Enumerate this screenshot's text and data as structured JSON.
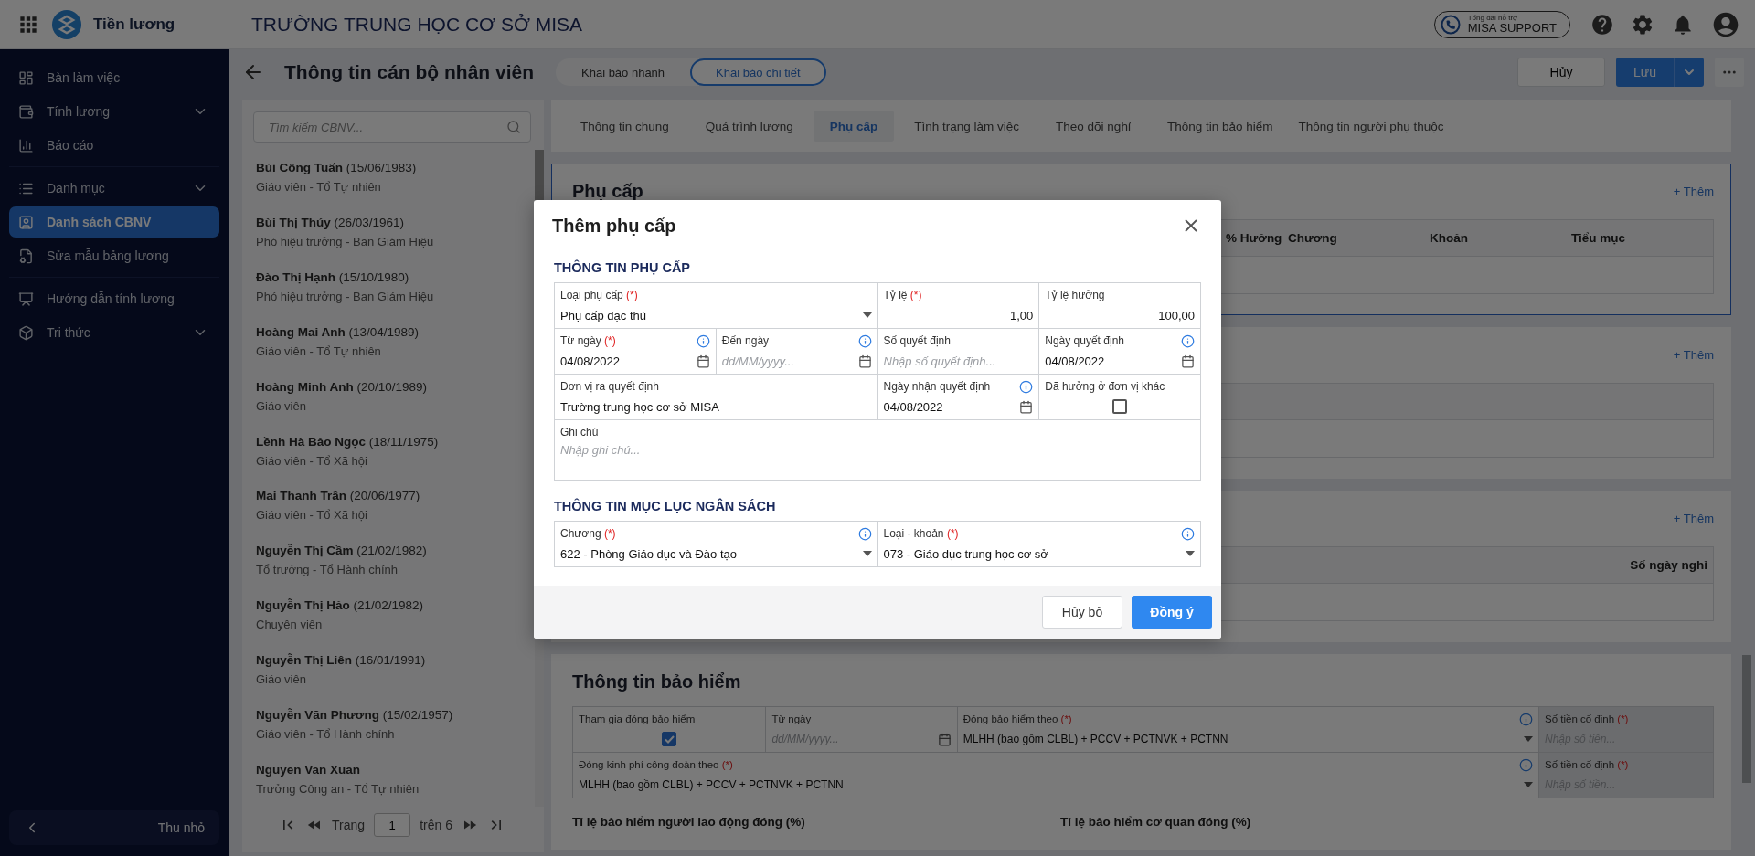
{
  "top_bar": {
    "app_name": "Tiền lương",
    "org_name": "TRƯỜNG TRUNG HỌC CƠ SỞ MISA",
    "support": {
      "caption": "Tổng đài hỗ trợ",
      "label": "MISA SUPPORT"
    }
  },
  "sidebar": {
    "groups": [
      {
        "items": [
          {
            "label": "Bàn làm việc",
            "selected": false,
            "expandable": false
          },
          {
            "label": "Tính lương",
            "selected": false,
            "expandable": true
          },
          {
            "label": "Báo cáo",
            "selected": false,
            "expandable": false
          }
        ]
      },
      {
        "items": [
          {
            "label": "Danh mục",
            "selected": false,
            "expandable": true
          },
          {
            "label": "Danh sách CBNV",
            "selected": true,
            "expandable": false
          },
          {
            "label": "Sửa mẫu bảng lương",
            "selected": false,
            "expandable": false
          }
        ]
      },
      {
        "items": [
          {
            "label": "Hướng dẫn tính lương",
            "selected": false,
            "expandable": false
          },
          {
            "label": "Tri thức",
            "selected": false,
            "expandable": true
          }
        ]
      }
    ],
    "collapse_label": "Thu nhỏ"
  },
  "page_header": {
    "title": "Thông tin cán bộ nhân viên",
    "modes": [
      {
        "label": "Khai báo nhanh",
        "selected": false
      },
      {
        "label": "Khai báo chi tiết",
        "selected": true
      }
    ],
    "cancel_label": "Hủy",
    "save_label": "Lưu"
  },
  "employee_list": {
    "search_placeholder": "Tìm kiếm CBNV...",
    "employees": [
      {
        "name": "Bùi Công Tuấn",
        "birth": "(15/06/1983)",
        "role": "Giáo viên - Tổ Tự nhiên"
      },
      {
        "name": "Bùi Thị Thúy",
        "birth": "(26/03/1961)",
        "role": "Phó hiệu trưởng - Ban Giám Hiệu"
      },
      {
        "name": "Đào Thị Hạnh",
        "birth": "(15/10/1980)",
        "role": "Phó hiệu trưởng - Ban Giám Hiệu"
      },
      {
        "name": "Hoàng Mai Anh",
        "birth": "(13/04/1989)",
        "role": "Giáo viên - Tổ Tự nhiên"
      },
      {
        "name": "Hoàng Minh Anh",
        "birth": "(20/10/1989)",
        "role": "Giáo viên"
      },
      {
        "name": "Lềnh Hà Bảo Ngọc",
        "birth": "(18/11/1975)",
        "role": "Giáo viên - Tổ Xã hội"
      },
      {
        "name": "Mai Thanh Trần",
        "birth": "(20/06/1977)",
        "role": "Giáo viên - Tổ Xã hội"
      },
      {
        "name": "Nguyễn Thị Cầm",
        "birth": "(21/02/1982)",
        "role": "Tổ trưởng - Tổ Hành chính"
      },
      {
        "name": "Nguyễn Thị Hảo",
        "birth": "(21/02/1982)",
        "role": "Chuyên viên"
      },
      {
        "name": "Nguyễn Thị Liên",
        "birth": "(16/01/1991)",
        "role": "Giáo viên"
      },
      {
        "name": "Nguyễn Văn Phương",
        "birth": "(15/02/1957)",
        "role": "Giáo viên - Tổ Hành chính"
      },
      {
        "name": "Nguyen Van Xuan",
        "role": "Trưởng Công an - Tổ Tự nhiên"
      }
    ],
    "pagination": {
      "page_label": "Trang",
      "page": "1",
      "total_label": "trên 6"
    }
  },
  "tabs": [
    {
      "label": "Thông tin chung",
      "selected": false
    },
    {
      "label": "Quá trình lương",
      "selected": false
    },
    {
      "label": "Phụ cấp",
      "selected": true
    },
    {
      "label": "Tình trạng làm việc",
      "selected": false
    },
    {
      "label": "Theo dõi nghỉ",
      "selected": false
    },
    {
      "label": "Thông tin bảo hiểm",
      "selected": false
    },
    {
      "label": "Thông tin người phụ thuộc",
      "selected": false
    }
  ],
  "sections": [
    {
      "title": "Phụ cấp",
      "add_label": "+ Thêm",
      "focused": true,
      "columns": [
        "% Hưởng",
        "Chương",
        "Khoản",
        "Tiểu mục"
      ]
    },
    {
      "add_label": "+ Thêm",
      "focused": false
    },
    {
      "add_label": "+ Thêm",
      "focused": false,
      "columns": [
        "Số ngày nghỉ"
      ]
    }
  ],
  "insurance": {
    "title": "Thông tin bảo hiểm",
    "fields": [
      {
        "kind": "checkbox",
        "label": "Tham gia đóng bảo hiểm",
        "checked": true,
        "disabled": false
      },
      {
        "kind": "date",
        "label": "Từ ngày",
        "placeholder": "dd/MM/yyyy...",
        "disabled": false
      },
      {
        "kind": "select",
        "label": "Đóng bảo hiểm theo",
        "mark": "(*)",
        "info": true,
        "value": "MLHH (bao gồm CLBL) + PCCV + PCTNVK + PCTNN",
        "disabled": false
      },
      {
        "kind": "text",
        "label": "Số tiền cố định",
        "mark": "(*)",
        "placeholder": "Nhập số tiền...",
        "disabled": true
      },
      {
        "kind": "select",
        "label": "Đóng kinh phí công đoàn theo",
        "mark": "(*)",
        "info": true,
        "value": "MLHH (bao gồm CLBL) + PCCV + PCTNVK + PCTNN",
        "disabled": false
      },
      {
        "kind": "text",
        "label": "Số tiền cố định",
        "mark": "(*)",
        "placeholder": "Nhập số tiền...",
        "disabled": true
      }
    ],
    "rate_labels": [
      "Tỉ lệ bảo hiểm người lao động đóng (%)",
      "Tỉ lệ bảo hiểm cơ quan đóng (%)"
    ]
  },
  "dialog": {
    "title": "Thêm phụ cấp",
    "sections": [
      {
        "heading": "THÔNG TIN PHỤ CẤP",
        "fields": [
          {
            "kind": "select",
            "label": "Loại phụ cấp",
            "mark": "(*)",
            "value": "Phụ cấp đặc thù"
          },
          {
            "kind": "number",
            "label": "Tỷ lệ",
            "mark": "(*)",
            "value": "1,00"
          },
          {
            "kind": "number",
            "label": "Tỷ lệ hưởng",
            "value": "100,00"
          },
          {
            "kind": "date",
            "label": "Từ ngày",
            "mark": "(*)",
            "info": true,
            "value": "04/08/2022"
          },
          {
            "kind": "date",
            "label": "Đến ngày",
            "info": true,
            "placeholder": "dd/MM/yyyy..."
          },
          {
            "kind": "text",
            "label": "Số quyết định",
            "placeholder": "Nhập số quyết định..."
          },
          {
            "kind": "date",
            "label": "Ngày quyết định",
            "info": true,
            "value": "04/08/2022"
          },
          {
            "kind": "text",
            "label": "Đơn vị ra quyết định",
            "value": "Trường trung học cơ sở MISA"
          },
          {
            "kind": "date",
            "label": "Ngày nhận quyết định",
            "info": true,
            "value": "04/08/2022"
          },
          {
            "kind": "checkbox",
            "label": "Đã hưởng ở đơn vị khác",
            "checked": false
          },
          {
            "kind": "textarea",
            "label": "Ghi chú",
            "placeholder": "Nhập ghi chú..."
          }
        ]
      },
      {
        "heading": "THÔNG TIN MỤC LỤC NGÂN SÁCH",
        "fields": [
          {
            "kind": "select",
            "label": "Chương",
            "mark": "(*)",
            "info": true,
            "value": "622 - Phòng Giáo dục và Đào tạo"
          },
          {
            "kind": "select",
            "label": "Loại - khoản",
            "mark": "(*)",
            "info": true,
            "value": "073 - Giáo dục trung học cơ sở"
          }
        ]
      }
    ],
    "buttons": [
      {
        "label": "Hủy bỏ",
        "kind": "secondary"
      },
      {
        "label": "Đồng ý",
        "kind": "primary"
      }
    ]
  }
}
